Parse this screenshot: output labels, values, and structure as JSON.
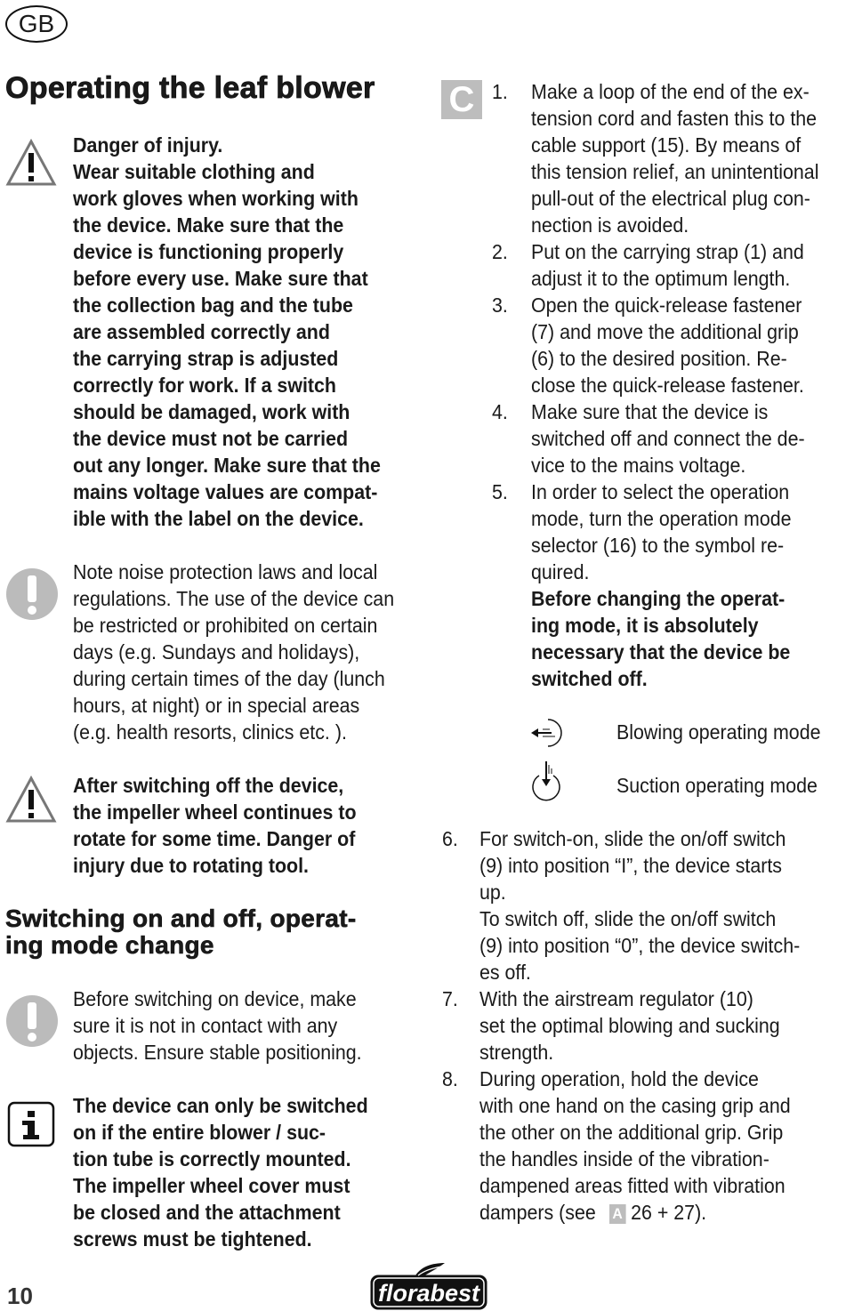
{
  "header": {
    "country_badge": "GB"
  },
  "left": {
    "title": "Operating the leaf blower",
    "warning1": [
      "Danger of injury.",
      "Wear suitable clothing and",
      "work gloves when working with",
      "the device. Make sure that the",
      "device is functioning properly",
      "before every use. Make sure that",
      "the collection bag and the tube",
      "are assembled correctly and",
      "the carrying strap is adjusted",
      "correctly for work. If a switch",
      "should be damaged, work with",
      "the device must not be carried",
      "out any longer. Make sure that the",
      "mains voltage values are compat-",
      "ible with the label on the device."
    ],
    "note1": [
      "Note noise protection laws and local",
      "regulations. The use of the device can",
      "be restricted or prohibited on certain",
      "days (e.g. Sundays and holidays),",
      "during certain times of the day (lunch",
      "hours, at night) or in special areas",
      "(e.g. health resorts, clinics etc. )."
    ],
    "warning2": [
      "After switching off the device,",
      "the impeller wheel continues to",
      "rotate for some time. Danger of",
      "injury due to rotating tool."
    ],
    "heading2": [
      "Switching on and off, operat-",
      "ing mode change"
    ],
    "note2": [
      "Before switching on device, make",
      "sure it is not in contact with any",
      "objects. Ensure stable positioning."
    ],
    "info": [
      "The device can only be switched",
      "on if the entire blower / suc-",
      "tion tube is correctly mounted.",
      "The impeller wheel cover must",
      "be closed and the attachment",
      "screws must be tightened."
    ]
  },
  "right": {
    "section_badge": "C",
    "steps_a": [
      {
        "num": "1.",
        "lines": [
          "Make a loop of the end of the ex-",
          "tension cord and fasten this to the",
          "cable support (15). By means of",
          "this tension relief, an unintentional",
          "pull-out of the electrical plug con-",
          "nection is avoided."
        ]
      },
      {
        "num": "2.",
        "lines": [
          "Put on the carrying strap (1) and",
          "adjust it to the optimum length."
        ]
      },
      {
        "num": "3.",
        "lines": [
          "Open the quick-release fastener",
          "(7) and move the additional grip",
          "(6) to the desired position. Re-",
          "close the quick-release fastener."
        ]
      },
      {
        "num": "4.",
        "lines": [
          "Make sure that the device is",
          "switched off and connect the de-",
          "vice to the mains voltage."
        ]
      },
      {
        "num": "5.",
        "lines": [
          "In order to select the operation",
          "mode, turn the operation mode",
          "selector (16) to the symbol re-",
          "quired."
        ],
        "bold": [
          "Before changing the operat-",
          "ing mode, it is absolutely",
          "necessary that the device be",
          "switched off."
        ]
      }
    ],
    "modes": [
      {
        "icon": "blowing-mode-icon",
        "label": "Blowing operating mode"
      },
      {
        "icon": "suction-mode-icon",
        "label": "Suction operating mode"
      }
    ],
    "steps_b": [
      {
        "num": "6.",
        "lines": [
          "For switch-on, slide the on/off switch",
          "(9) into position “I”, the device starts",
          "up.",
          "To switch off, slide the on/off switch",
          "(9) into position “0”, the device switch-",
          "es off."
        ]
      },
      {
        "num": "7.",
        "lines": [
          "With the airstream regulator (10)",
          "set the optimal blowing and sucking",
          "strength."
        ]
      },
      {
        "num": "8.",
        "lines": [
          "During operation, hold the device",
          "with one hand on the casing grip and",
          "the other on the additional grip. Grip",
          "the handles inside of the vibration-",
          "dampened areas fitted with vibration"
        ]
      }
    ],
    "last_line": {
      "before": "dampers (see",
      "badge": "A",
      "after": "26 + 27)."
    }
  },
  "footer": {
    "page_number": "10",
    "logo_text": "florabest"
  }
}
